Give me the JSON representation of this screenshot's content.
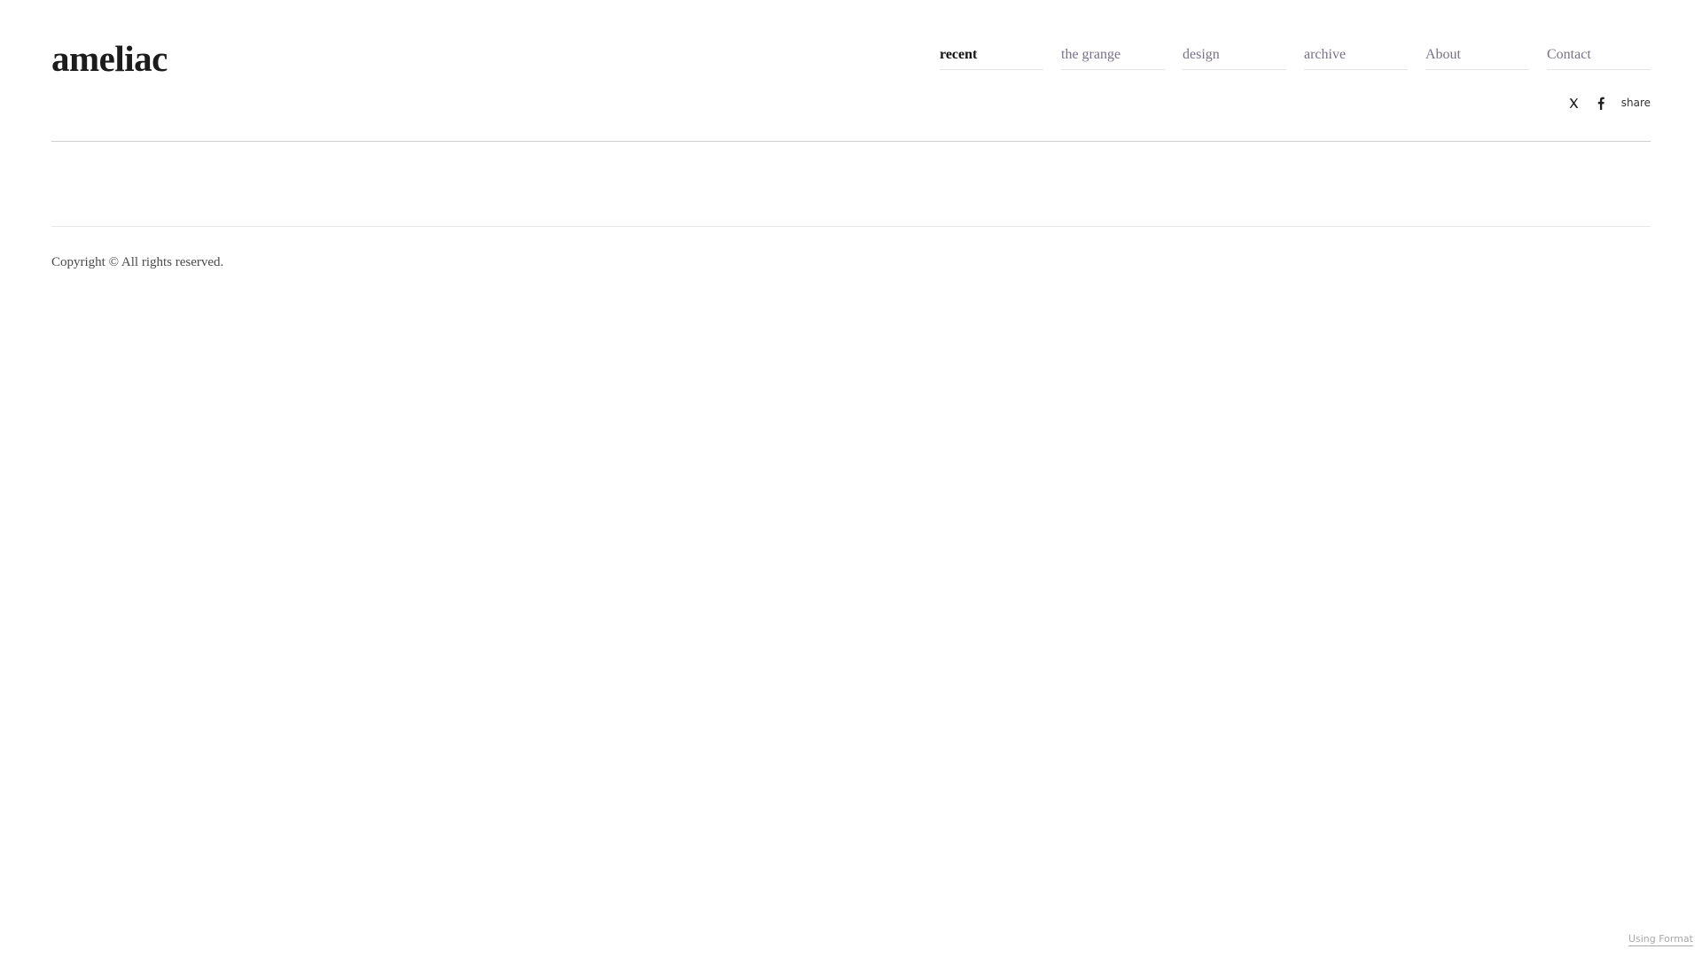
{
  "site": {
    "title": "ameliac"
  },
  "nav": {
    "items": [
      {
        "label": "recent",
        "active": true
      },
      {
        "label": "the grange",
        "active": false
      },
      {
        "label": "design",
        "active": false
      },
      {
        "label": "archive",
        "active": false
      },
      {
        "label": "About",
        "active": false
      },
      {
        "label": "Contact",
        "active": false
      }
    ]
  },
  "share": {
    "icons": [
      "x-icon",
      "facebook-icon"
    ],
    "label": "share"
  },
  "footer": {
    "copyright": "Copyright © All rights reserved.",
    "powered_by": "Using Format"
  },
  "colors": {
    "nav_text": "#7a7285",
    "nav_active": "#111111",
    "title": "#1c1c1c"
  }
}
